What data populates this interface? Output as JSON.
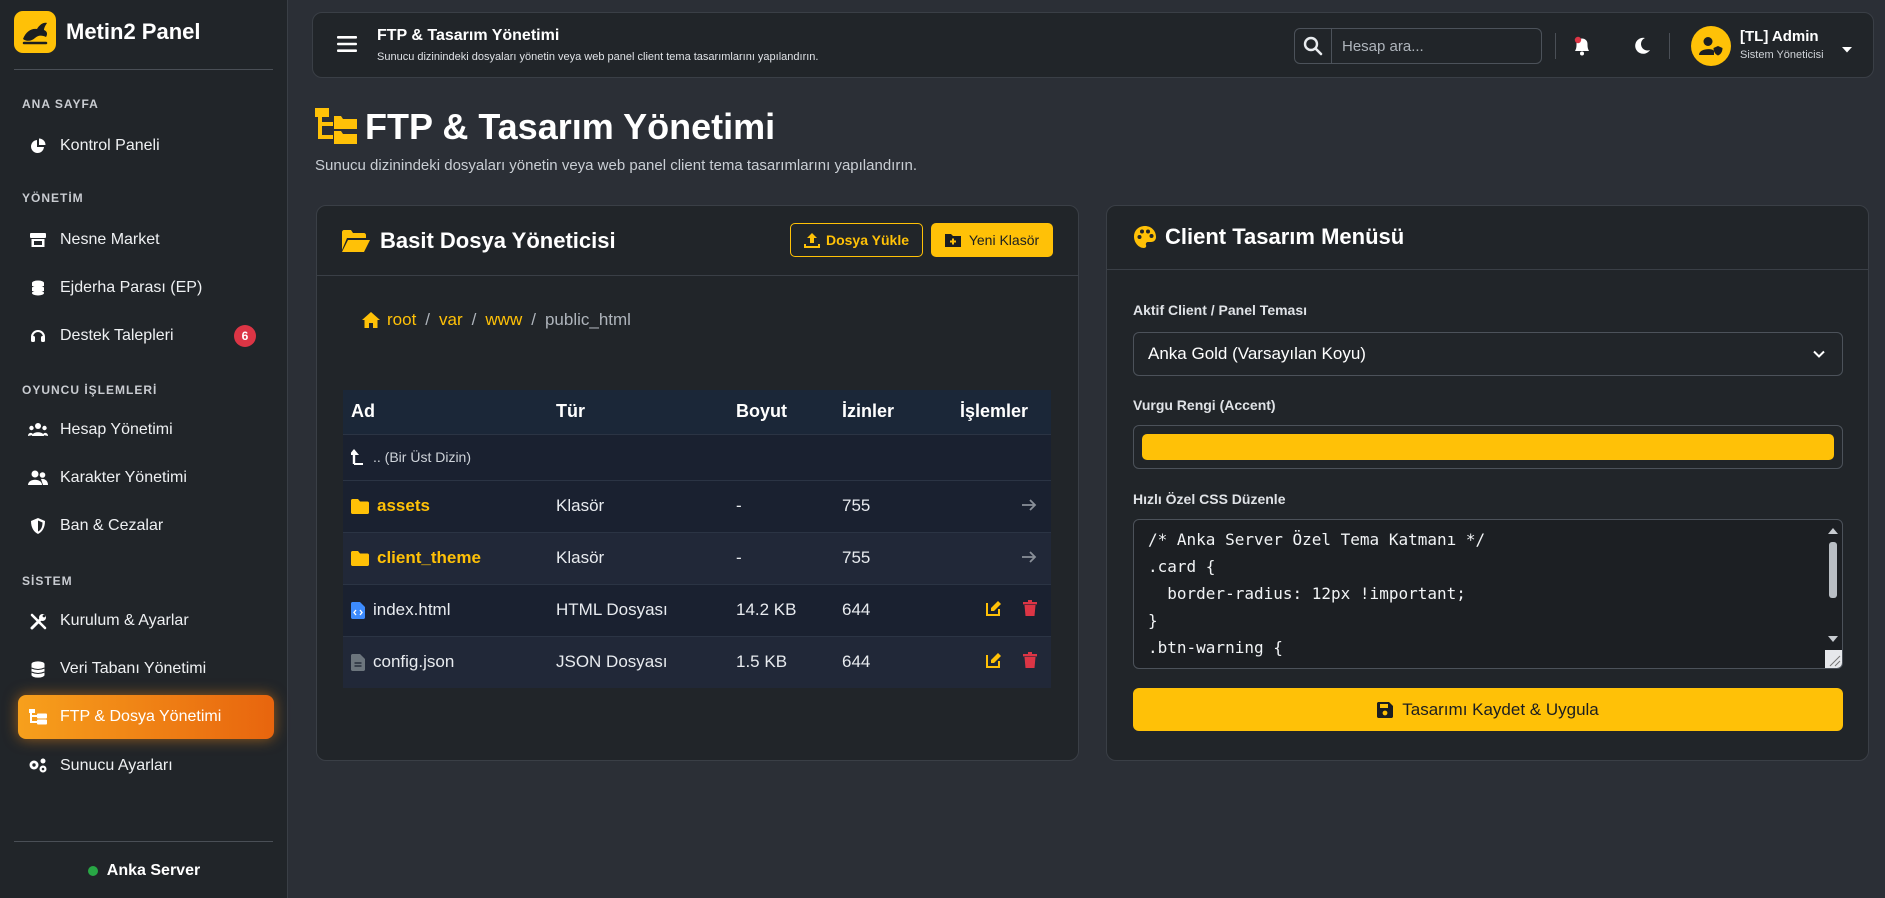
{
  "brand": {
    "name": "Metin2 Panel"
  },
  "sidebar": {
    "sections": [
      "ANA SAYFA",
      "YÖNETİM",
      "OYUNCU İŞLEMLERİ",
      "SİSTEM"
    ],
    "items": [
      {
        "label": "Kontrol Paneli",
        "icon": "chart-pie-icon"
      },
      {
        "label": "Nesne Market",
        "icon": "store-icon"
      },
      {
        "label": "Ejderha Parası (EP)",
        "icon": "coins-icon"
      },
      {
        "label": "Destek Talepleri",
        "icon": "headset-icon",
        "badge": "6"
      },
      {
        "label": "Hesap Yönetimi",
        "icon": "users-icon"
      },
      {
        "label": "Karakter Yönetimi",
        "icon": "user-group-icon"
      },
      {
        "label": "Ban & Cezalar",
        "icon": "shield-icon"
      },
      {
        "label": "Kurulum & Ayarlar",
        "icon": "tools-icon"
      },
      {
        "label": "Veri Tabanı Yönetimi",
        "icon": "database-icon"
      },
      {
        "label": "FTP & Dosya Yönetimi",
        "icon": "folder-tree-icon",
        "active": true
      },
      {
        "label": "Sunucu Ayarları",
        "icon": "gears-icon"
      }
    ],
    "footer": {
      "label": "Anka Server",
      "status_color": "#28a745"
    }
  },
  "topbar": {
    "title": "FTP & Tasarım Yönetimi",
    "subtitle": "Sunucu dizinindeki dosyaları yönetin veya web panel client tema tasarımlarını yapılandırın.",
    "search_placeholder": "Hesap ara...",
    "user": {
      "name": "[TL] Admin",
      "role": "Sistem Yöneticisi"
    }
  },
  "page": {
    "title": "FTP & Tasarım Yönetimi",
    "subtitle": "Sunucu dizinindeki dosyaları yönetin veya web panel client tema tasarımlarını yapılandırın."
  },
  "file_manager": {
    "title": "Basit Dosya Yöneticisi",
    "upload_label": "Dosya Yükle",
    "new_folder_label": "Yeni Klasör",
    "breadcrumb": [
      "root",
      "var",
      "www",
      "public_html"
    ],
    "columns": [
      "Ad",
      "Tür",
      "Boyut",
      "İzinler",
      "İşlemler"
    ],
    "up_label": ".. (Bir Üst Dizin)",
    "rows": [
      {
        "name": "assets",
        "type": "Klasör",
        "size": "-",
        "perm": "755",
        "kind": "folder"
      },
      {
        "name": "client_theme",
        "type": "Klasör",
        "size": "-",
        "perm": "755",
        "kind": "folder"
      },
      {
        "name": "index.html",
        "type": "HTML Dosyası",
        "size": "14.2 KB",
        "perm": "644",
        "kind": "file"
      },
      {
        "name": "config.json",
        "type": "JSON Dosyası",
        "size": "1.5 KB",
        "perm": "644",
        "kind": "file"
      }
    ]
  },
  "design": {
    "title": "Client Tasarım Menüsü",
    "theme_label": "Aktif Client / Panel Teması",
    "theme_value": "Anka Gold (Varsayılan Koyu)",
    "accent_label": "Vurgu Rengi (Accent)",
    "accent_color": "#ffc107",
    "css_label": "Hızlı Özel CSS Düzenle",
    "css_code": "/* Anka Server Özel Tema Katmanı */\n.card {\n  border-radius: 12px !important;\n}\n.btn-warning {",
    "save_label": "Tasarımı Kaydet & Uygula"
  }
}
